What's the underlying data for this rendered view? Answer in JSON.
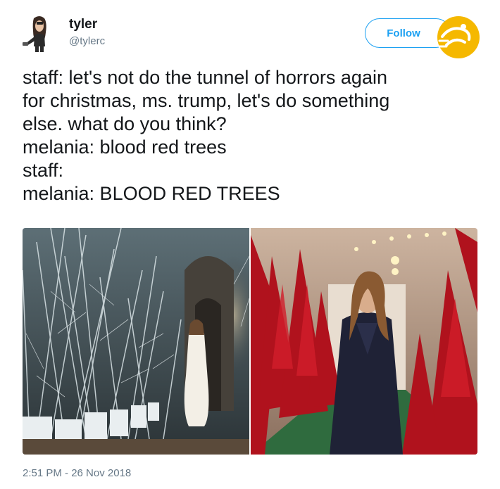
{
  "user": {
    "display_name": "tyler",
    "handle": "@tylerc"
  },
  "follow_button": {
    "label": "Follow"
  },
  "tweet": {
    "lines": [
      "staff: let's not do the tunnel of horrors again",
      "for christmas, ms. trump, let's do something",
      "else. what do you think?",
      "melania: blood red trees",
      "staff:",
      "melania: BLOOD RED TREES"
    ],
    "timestamp": "2:51 PM - 26 Nov 2018"
  },
  "icons": {
    "avatar": "cartoon-avatar-icon",
    "watermark": "yellow-badge-icon"
  },
  "colors": {
    "accent": "#1da1f2",
    "text": "#14171a",
    "muted": "#657786",
    "watermark": "#f5b800"
  }
}
